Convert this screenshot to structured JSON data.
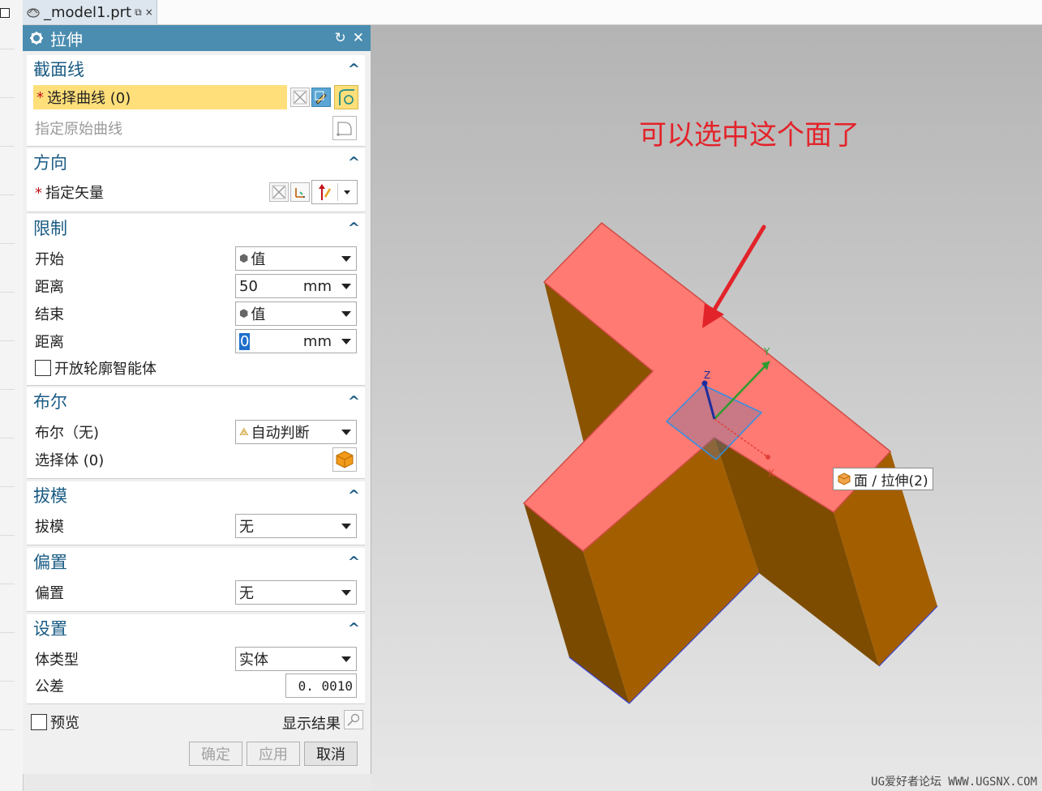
{
  "tab": {
    "filename": "_model1.prt",
    "pin_glyph": "⧉",
    "close_glyph": "×"
  },
  "dialog": {
    "title": "拉伸",
    "reset_glyph": "↻",
    "close_glyph": "✕",
    "sections": {
      "section": {
        "title": "截面线",
        "select_curve": "选择曲线 (0)",
        "specify_original": "指定原始曲线"
      },
      "direction": {
        "title": "方向",
        "specify_vector": "指定矢量"
      },
      "limits": {
        "title": "限制",
        "start_label": "开始",
        "start_value": "值",
        "distance1_label": "距离",
        "distance1_value": "50",
        "distance1_unit": "mm",
        "end_label": "结束",
        "end_value": "值",
        "distance2_label": "距离",
        "distance2_value": "0",
        "distance2_unit": "mm",
        "open_profile": "开放轮廓智能体"
      },
      "boolean": {
        "title": "布尔",
        "boolean_label": "布尔（无)",
        "boolean_value": "自动判断",
        "select_body": "选择体 (0)"
      },
      "draft": {
        "title": "拔模",
        "draft_label": "拔模",
        "draft_value": "无"
      },
      "offset": {
        "title": "偏置",
        "offset_label": "偏置",
        "offset_value": "无"
      },
      "settings": {
        "title": "设置",
        "body_type_label": "体类型",
        "body_type_value": "实体",
        "tolerance_label": "公差",
        "tolerance_value": "0. 0010"
      }
    },
    "preview_label": "预览",
    "show_result_label": "显示结果",
    "buttons": {
      "ok": "确定",
      "apply": "应用",
      "cancel": "取消"
    },
    "collapse_glyph": "^"
  },
  "viewport": {
    "annotation": "可以选中这个面了",
    "face_tooltip": "面 / 拉伸(2)",
    "axis_labels": {
      "x": "X",
      "y": "Y",
      "z": "Z"
    },
    "watermark": "UG爱好者论坛 WWW.UGSNX.COM"
  },
  "colors": {
    "title_bar": "#4a8db0",
    "section_title": "#1a5b84",
    "highlight_row": "#ffdf7a",
    "selected_face": "#ff7a72",
    "body_side": "#a35e00",
    "annotation_red": "#e3232a"
  }
}
